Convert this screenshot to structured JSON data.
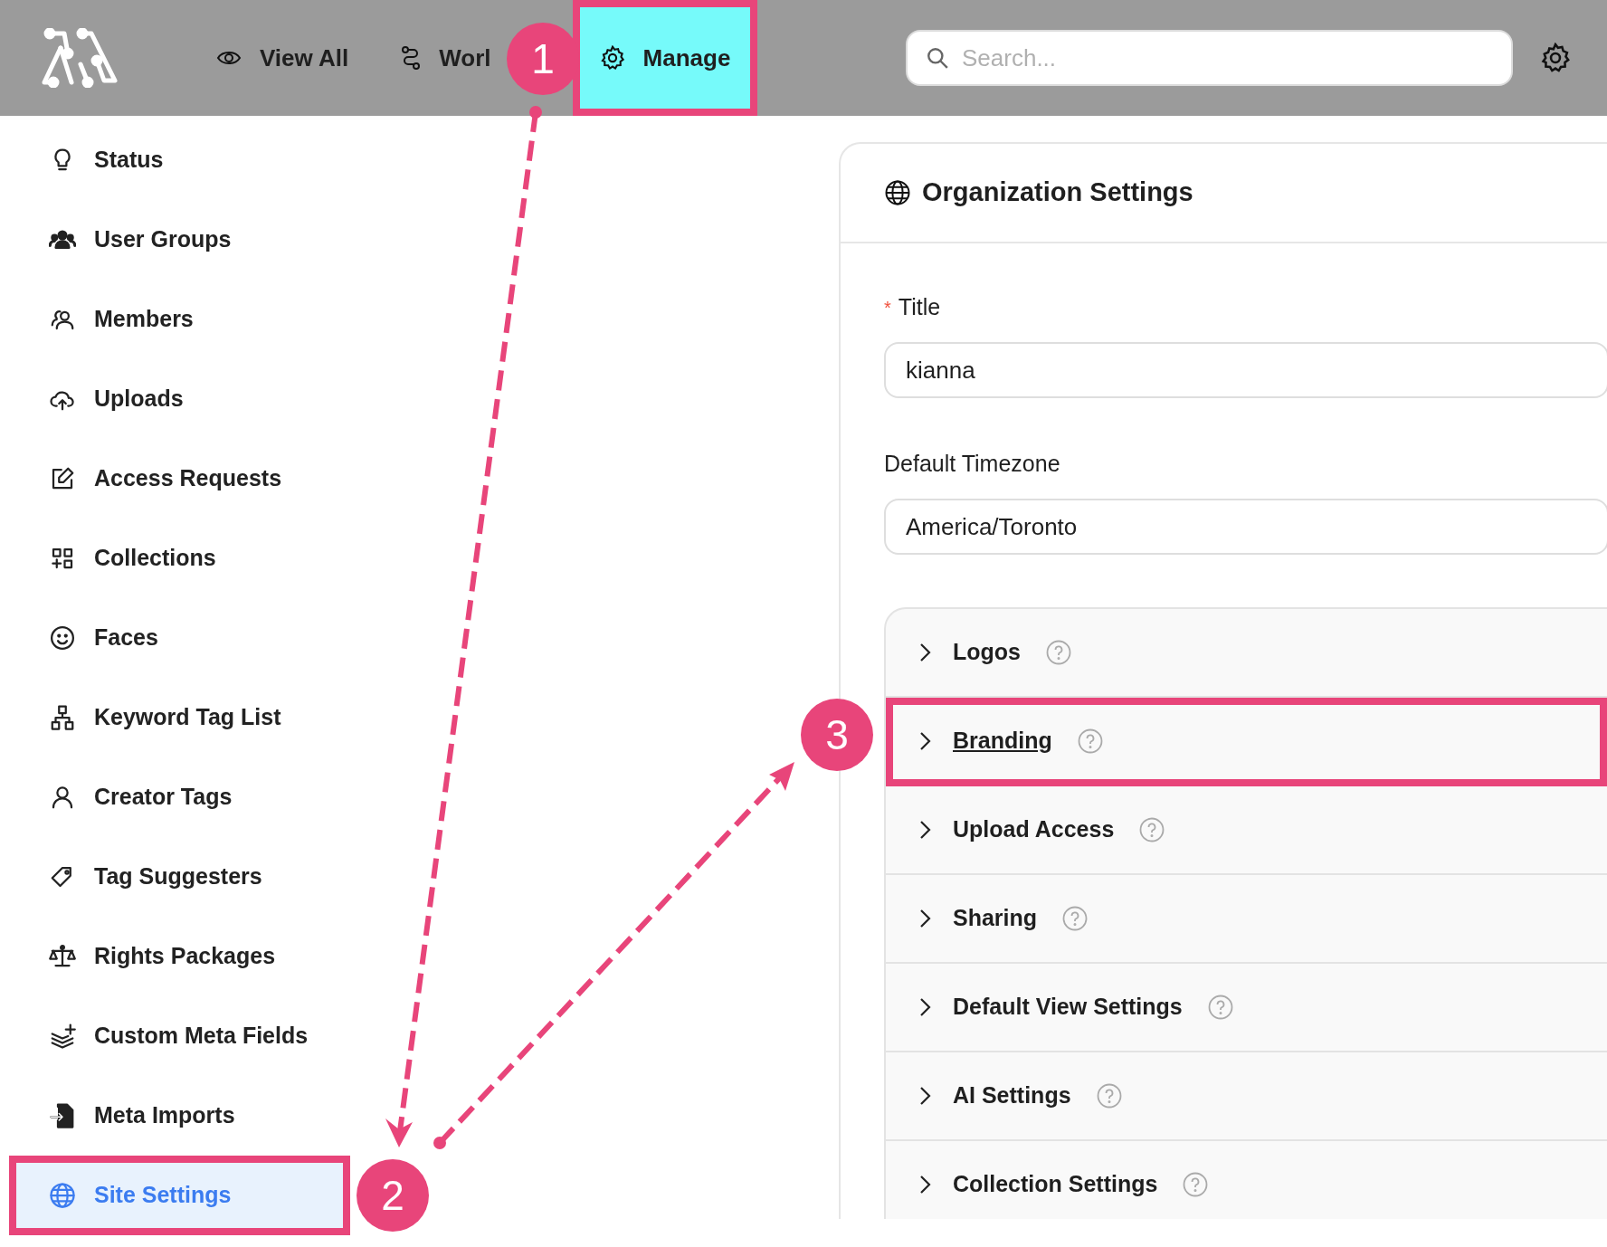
{
  "top_bar": {
    "nav": [
      {
        "label": "View All",
        "selected": false,
        "highlighted": false
      },
      {
        "label": "Worl",
        "selected": false,
        "highlighted": false
      },
      {
        "label": "Manage",
        "selected": true,
        "highlighted": true
      }
    ],
    "search": {
      "placeholder": "Search..."
    }
  },
  "sidebar": {
    "items": [
      {
        "label": "Status",
        "selected": false,
        "highlighted": false
      },
      {
        "label": "User Groups",
        "selected": false,
        "highlighted": false
      },
      {
        "label": "Members",
        "selected": false,
        "highlighted": false
      },
      {
        "label": "Uploads",
        "selected": false,
        "highlighted": false
      },
      {
        "label": "Access Requests",
        "selected": false,
        "highlighted": false
      },
      {
        "label": "Collections",
        "selected": false,
        "highlighted": false
      },
      {
        "label": "Faces",
        "selected": false,
        "highlighted": false
      },
      {
        "label": "Keyword Tag List",
        "selected": false,
        "highlighted": false
      },
      {
        "label": "Creator Tags",
        "selected": false,
        "highlighted": false
      },
      {
        "label": "Tag Suggesters",
        "selected": false,
        "highlighted": false
      },
      {
        "label": "Rights Packages",
        "selected": false,
        "highlighted": false
      },
      {
        "label": "Custom Meta Fields",
        "selected": false,
        "highlighted": false
      },
      {
        "label": "Meta Imports",
        "selected": false,
        "highlighted": false
      },
      {
        "label": "Site Settings",
        "selected": true,
        "highlighted": true
      }
    ]
  },
  "panel": {
    "title": "Organization Settings",
    "fields": [
      {
        "label": "Title",
        "required_mark": "*",
        "value": "kianna"
      },
      {
        "label": "Default Timezone",
        "value": "America/Toronto"
      }
    ],
    "sections": [
      {
        "title": "Logos",
        "hovered": false,
        "highlighted": false
      },
      {
        "title": "Branding",
        "hovered": true,
        "highlighted": true
      },
      {
        "title": "Upload Access",
        "hovered": false,
        "highlighted": false
      },
      {
        "title": "Sharing",
        "hovered": false,
        "highlighted": false
      },
      {
        "title": "Default View Settings",
        "hovered": false,
        "highlighted": false
      },
      {
        "title": "AI Settings",
        "hovered": false,
        "highlighted": false
      },
      {
        "title": "Collection Settings",
        "hovered": false,
        "highlighted": false
      }
    ]
  },
  "annotations": [
    {
      "label": "1"
    },
    {
      "label": "2"
    },
    {
      "label": "3"
    }
  ]
}
